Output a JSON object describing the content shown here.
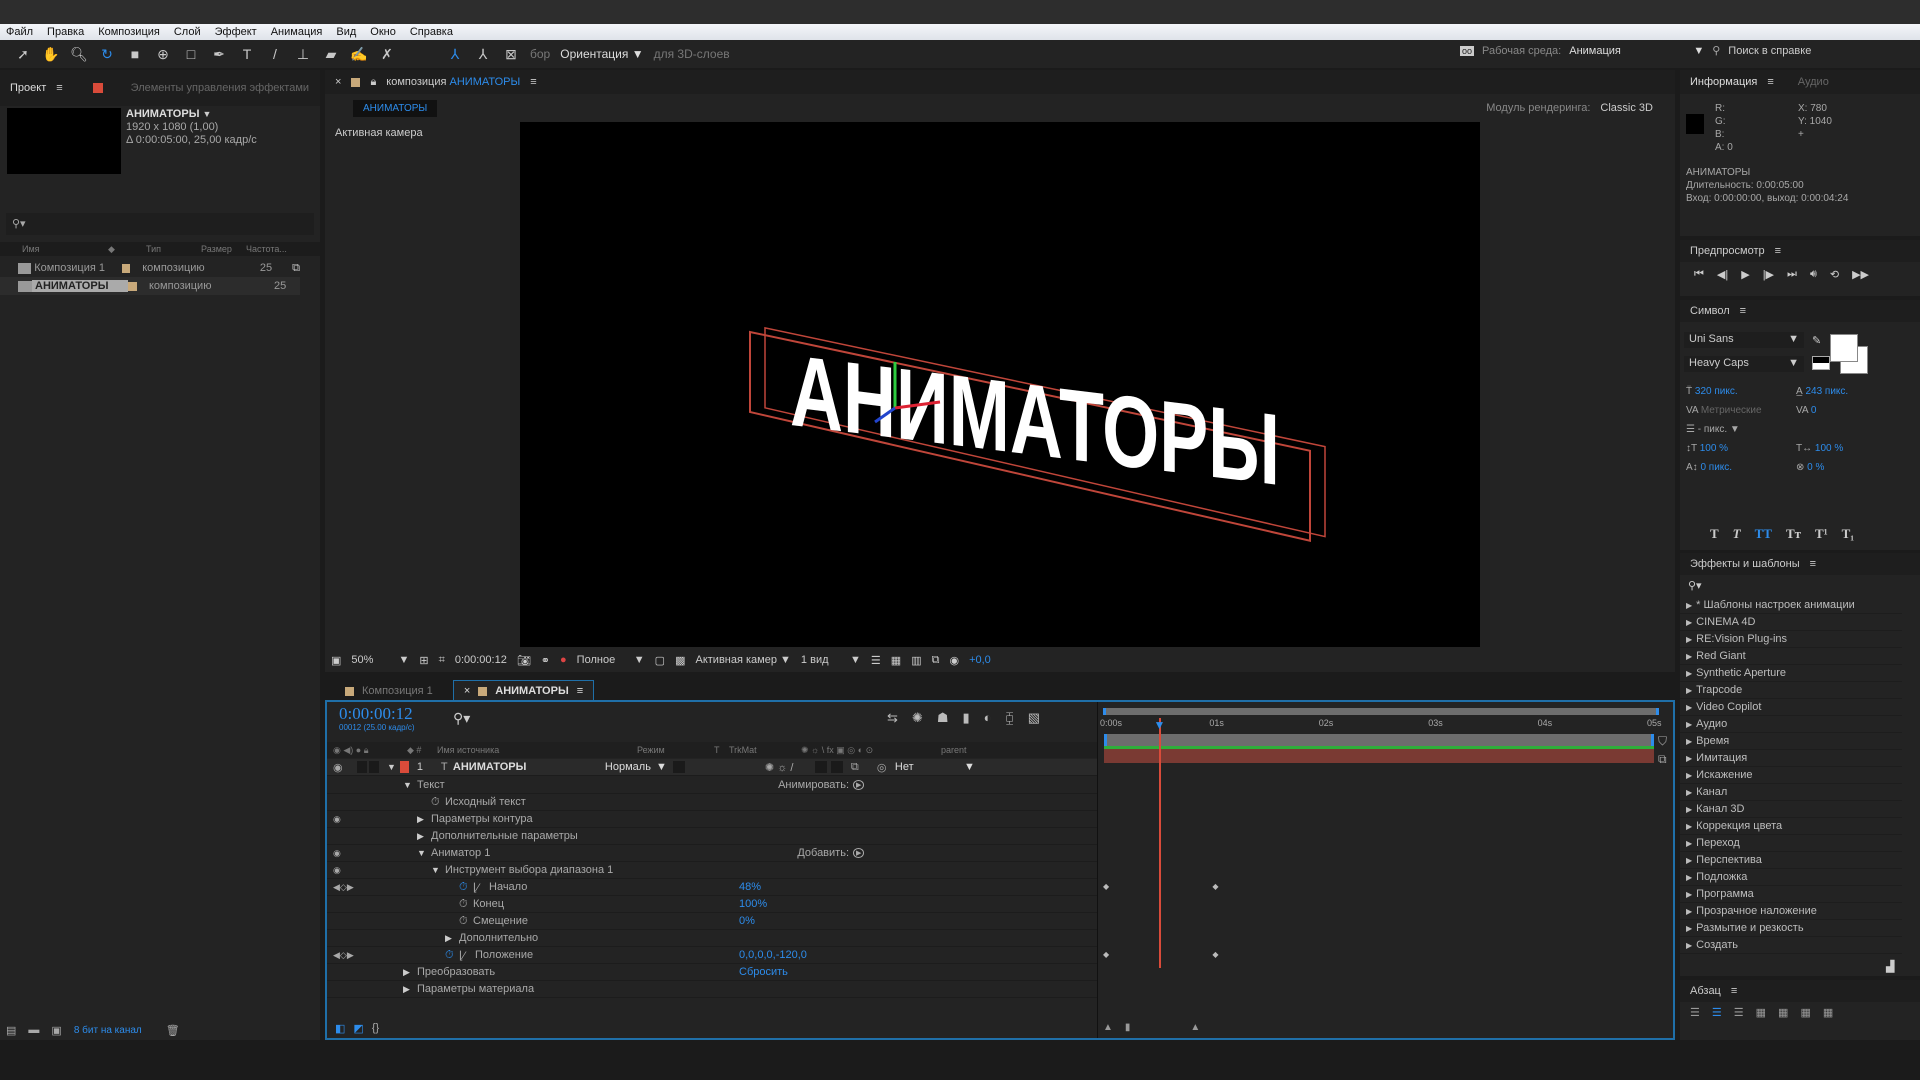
{
  "menu": [
    "Файл",
    "Правка",
    "Композиция",
    "Слой",
    "Эффект",
    "Анимация",
    "Вид",
    "Окно",
    "Справка"
  ],
  "toolbar": {
    "axis_label": "бор",
    "orientation": "Ориентация",
    "for3d": "для 3D-слоев",
    "workspace_label": "Рабочая среда:",
    "workspace_value": "Анимация",
    "help_search": "Поиск в справке"
  },
  "project": {
    "tab": "Проект",
    "effects_tab": "Элементы управления эффектами",
    "comp_name": "АНИМАТОРЫ",
    "resolution": "1920 x 1080 (1,00)",
    "duration": "Δ 0:00:05:00, 25,00 кадр/с",
    "columns": [
      "Имя",
      "Тип",
      "Размер",
      "Частота..."
    ],
    "items": [
      {
        "name": "Композиция 1",
        "type": "композицию",
        "fps": "25"
      },
      {
        "name": "АНИМАТОРЫ",
        "type": "композицию",
        "fps": "25"
      }
    ],
    "bit_depth": "8 бит на канал"
  },
  "comp": {
    "tab_prefix": "композиция",
    "tab_name": "АНИМАТОРЫ",
    "sub_tab": "АНИМАТОРЫ",
    "renderer_label": "Модуль рендеринга:",
    "renderer": "Classic 3D",
    "camera_label": "Активная камера",
    "text": "АНИМАТОРЫ",
    "zoom": "50%",
    "time": "0:00:00:12",
    "quality": "Полное",
    "camera": "Активная камер",
    "views": "1 вид",
    "exposure": "+0,0"
  },
  "timeline": {
    "tabs": [
      "Композиция 1",
      "АНИМАТОРЫ"
    ],
    "time": "0:00:00:12",
    "frames": "00012 (25.00 кадр/с)",
    "headers": {
      "source": "Имя источника",
      "mode": "Режим",
      "t": "T",
      "trkmat": "TrkMat",
      "parent": "parent"
    },
    "layer": {
      "num": "1",
      "name": "АНИМАТОРЫ",
      "mode": "Нормаль",
      "parent": "Нет",
      "color": "#d94b3a"
    },
    "props": [
      {
        "label": "Текст",
        "indent": 0,
        "twirl": "open",
        "extra": "Анимировать:"
      },
      {
        "label": "Исходный текст",
        "indent": 2,
        "stopwatch": true
      },
      {
        "label": "Параметры контура",
        "indent": 1,
        "twirl": "closed",
        "eye": true
      },
      {
        "label": "Дополнительные параметры",
        "indent": 1,
        "twirl": "closed"
      },
      {
        "label": "Аниматор 1",
        "indent": 1,
        "twirl": "open",
        "eye": true,
        "extra": "Добавить:"
      },
      {
        "label": "Инструмент выбора диапазона 1",
        "indent": 2,
        "twirl": "open",
        "eye": true
      },
      {
        "label": "Начало",
        "indent": 4,
        "stopwatch": true,
        "active": true,
        "value": "48%",
        "nav": true
      },
      {
        "label": "Конец",
        "indent": 4,
        "stopwatch": true,
        "value": "100%"
      },
      {
        "label": "Смещение",
        "indent": 4,
        "stopwatch": true,
        "value": "0%"
      },
      {
        "label": "Дополнительно",
        "indent": 3,
        "twirl": "closed"
      },
      {
        "label": "Положение",
        "indent": 3,
        "stopwatch": true,
        "active": true,
        "value": "0,0,0,0,-120,0",
        "nav": true
      },
      {
        "label": "Преобразовать",
        "indent": 0,
        "twirl": "closed",
        "value": "Сбросить"
      },
      {
        "label": "Параметры материала",
        "indent": 0,
        "twirl": "closed"
      }
    ],
    "ruler": [
      "0:00s",
      "01s",
      "02s",
      "03s",
      "04s",
      "05s"
    ],
    "duration_s": 5,
    "playhead_s": 0.48,
    "keyframes": [
      {
        "row": 6,
        "times": [
          0,
          1
        ]
      },
      {
        "row": 10,
        "times": [
          0,
          1
        ]
      }
    ]
  },
  "info": {
    "tab": "Информация",
    "audio_tab": "Аудио",
    "r": "R:",
    "g": "G:",
    "b": "B:",
    "a": "A: 0",
    "x": "X: 780",
    "y": "Y: 1040",
    "name": "АНИМАТОРЫ",
    "duration": "Длительность: 0:00:05:00",
    "inout": "Вход: 0:00:00:00, выход: 0:00:04:24"
  },
  "preview": {
    "tab": "Предпросмотр"
  },
  "symbol": {
    "tab": "Символ",
    "font": "Uni Sans",
    "style": "Heavy Caps",
    "size": "320 пикс.",
    "leading": "243 пикс.",
    "kerning": "Метрические",
    "tracking": "0",
    "stroke": "- пикс.",
    "vscale": "100 %",
    "hscale": "100 %",
    "baseline": "0 пикс.",
    "tsume": "0 %"
  },
  "effects": {
    "tab": "Эффекты и шаблоны",
    "items": [
      "* Шаблоны настроек анимации",
      "CINEMA 4D",
      "RE:Vision Plug-ins",
      "Red Giant",
      "Synthetic Aperture",
      "Trapcode",
      "Video Copilot",
      "Аудио",
      "Время",
      "Имитация",
      "Искажение",
      "Канал",
      "Канал 3D",
      "Коррекция цвета",
      "Переход",
      "Перспектива",
      "Подложка",
      "Программа",
      "Прозрачное наложение",
      "Размытие и резкость",
      "Создать"
    ]
  },
  "paragraph": {
    "tab": "Абзац"
  },
  "colors": {
    "accent": "#2d8ceb",
    "layer_bar": "#7a3a33",
    "playhead": "#d94b3a",
    "work_area": "#2fae3a"
  }
}
